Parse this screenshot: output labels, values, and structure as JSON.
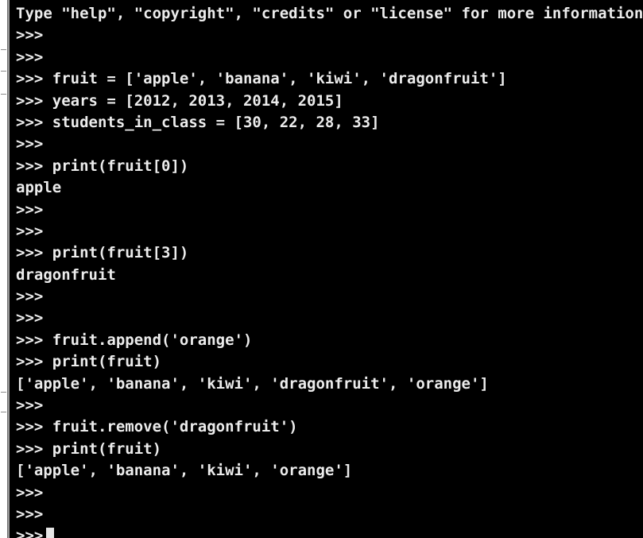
{
  "terminal": {
    "lines": [
      "Type \"help\", \"copyright\", \"credits\" or \"license\" for more information.",
      ">>>",
      ">>>",
      ">>> fruit = ['apple', 'banana', 'kiwi', 'dragonfruit']",
      ">>> years = [2012, 2013, 2014, 2015]",
      ">>> students_in_class = [30, 22, 28, 33]",
      ">>>",
      ">>> print(fruit[0])",
      "apple",
      ">>>",
      ">>>",
      ">>> print(fruit[3])",
      "dragonfruit",
      ">>>",
      ">>>",
      ">>> fruit.append('orange')",
      ">>> print(fruit)",
      "['apple', 'banana', 'kiwi', 'dragonfruit', 'orange']",
      ">>>",
      ">>> fruit.remove('dragonfruit')",
      ">>> print(fruit)",
      "['apple', 'banana', 'kiwi', 'orange']",
      ">>>",
      ">>>"
    ],
    "prompt": ">>>"
  },
  "colors": {
    "background": "#000000",
    "text": "#ececec",
    "cursor": "#e6e6e6"
  }
}
